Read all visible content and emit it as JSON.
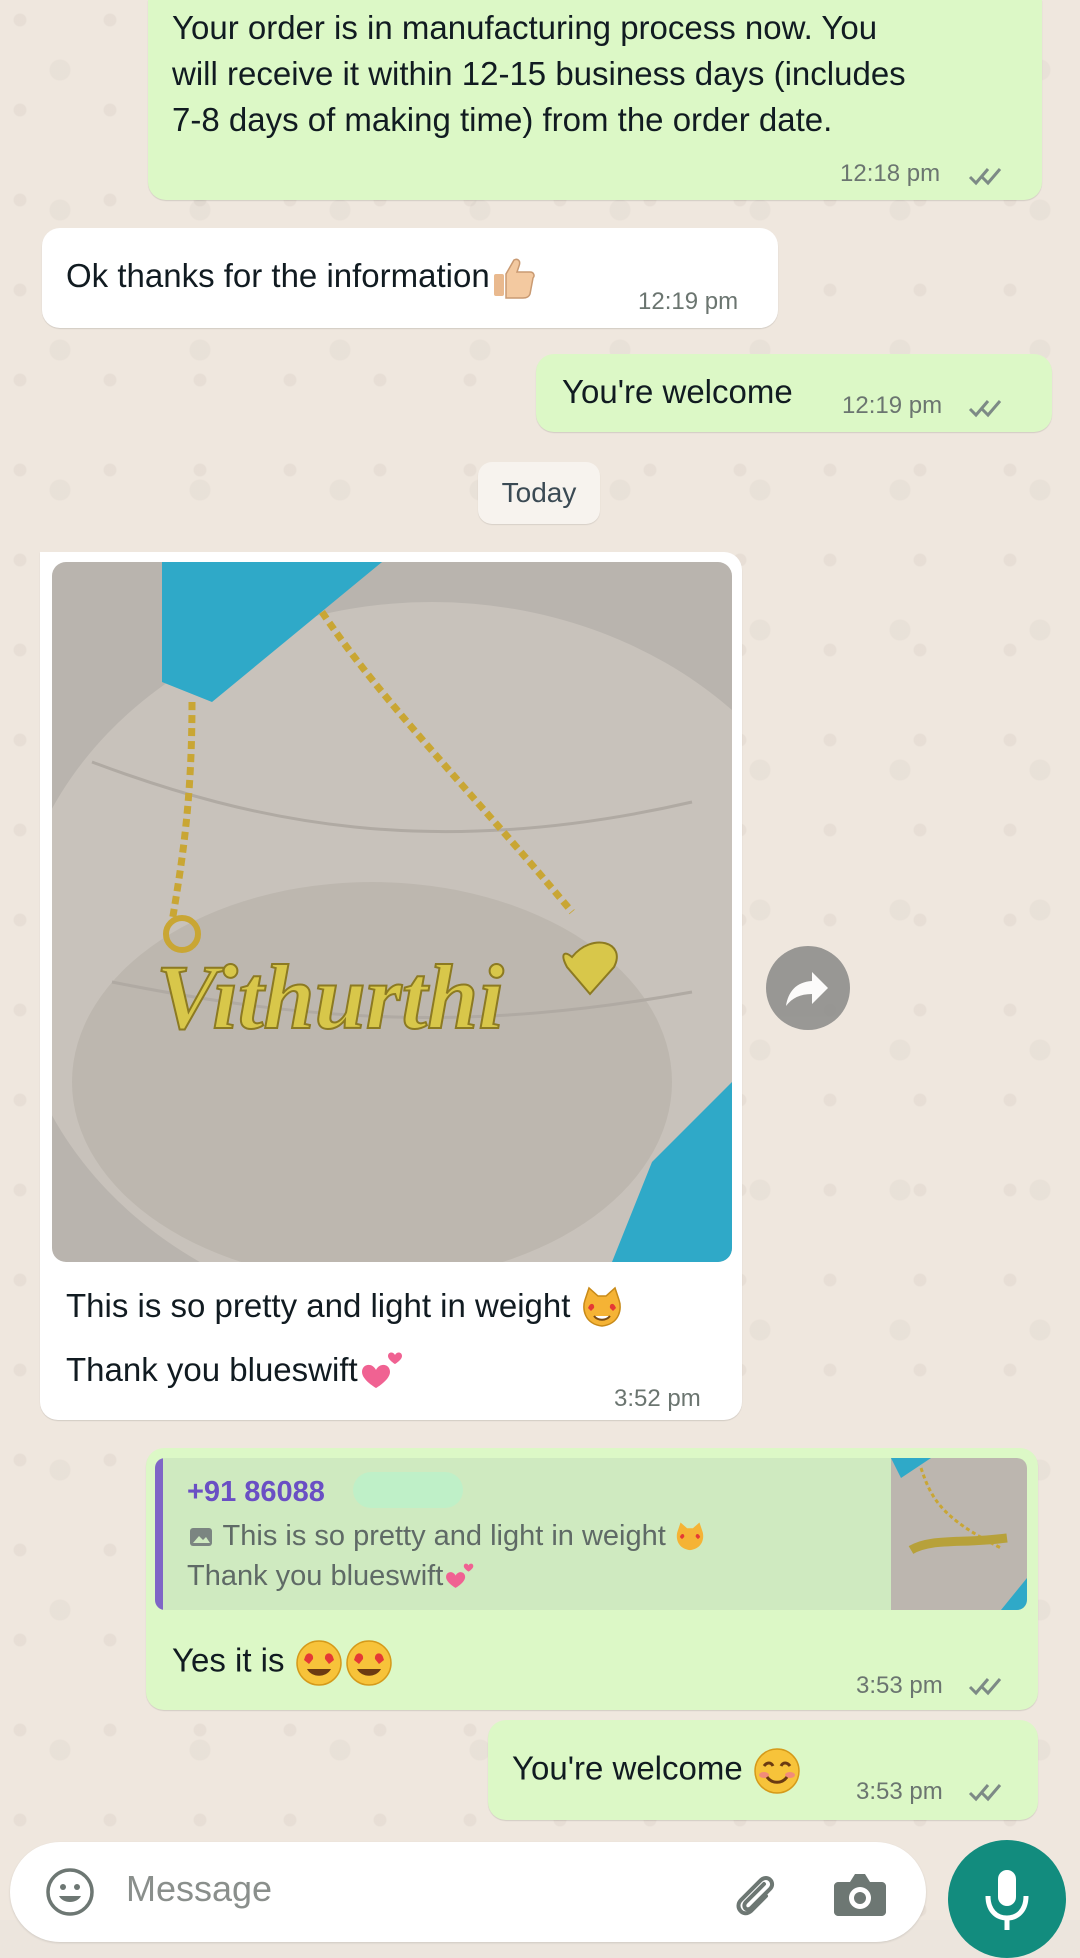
{
  "colors": {
    "outgoing_bubble": "#dcf8c6",
    "incoming_bubble": "#ffffff",
    "read_ticks": "#53bdeb",
    "reply_sender": "#6a4fc4",
    "mic_button": "#128c7e"
  },
  "messages": [
    {
      "direction": "outgoing",
      "lines": [
        "Your order is in manufacturing process now. You",
        "will receive it within 12-15 business days (includes",
        "7-8 days of making time) from the order date."
      ],
      "time": "12:18 pm"
    },
    {
      "direction": "incoming",
      "text": "Ok thanks for the information",
      "emoji": "thumbs-up",
      "time": "12:19 pm"
    },
    {
      "direction": "outgoing",
      "text": "You're welcome",
      "time": "12:19 pm"
    },
    {
      "direction": "incoming",
      "type": "image",
      "image_text": "Vithurthi",
      "caption_lines": [
        "This is so pretty and light in weight",
        "Thank you blueswift"
      ],
      "time": "3:52 pm"
    },
    {
      "direction": "outgoing",
      "reply": {
        "sender": "+91 86088",
        "lines": [
          "This is so pretty and light in weight",
          "Thank you blueswift"
        ]
      },
      "text": "Yes it is",
      "time": "3:53 pm"
    },
    {
      "direction": "outgoing",
      "text": "You're welcome",
      "time": "3:53 pm"
    }
  ],
  "date_separator": "Today",
  "composer": {
    "placeholder": "Message",
    "icons": [
      "emoji-icon",
      "attach-icon",
      "camera-icon",
      "mic-icon"
    ]
  }
}
